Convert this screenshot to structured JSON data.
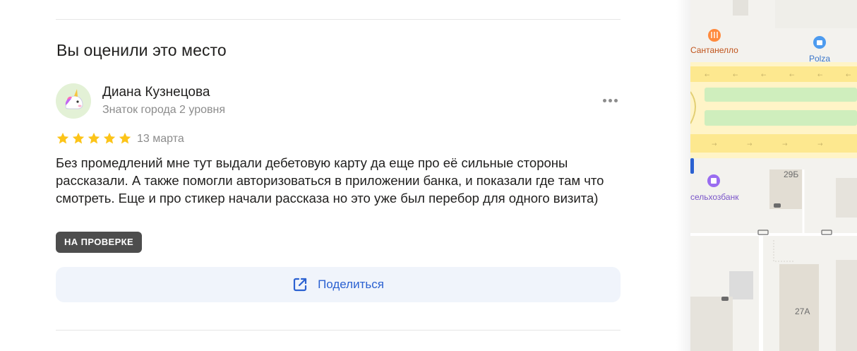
{
  "section_title": "Вы оценили это место",
  "review": {
    "author": "Диана Кузнецова",
    "author_level": "Знаток города 2 уровня",
    "rating": 5,
    "date": "13 марта",
    "text": "Без промедлений мне тут выдали дебетовую карту да еще про её сильные стороны рассказали. А также помогли авторизоваться в приложении банка, и показали где там что смотреть. Еще и про стикер начали рассказа но это уже был перебор для одного визита)",
    "status_badge": "НА ПРОВЕРКЕ",
    "avatar_icon": "unicorn-icon"
  },
  "actions": {
    "share_label": "Поделиться",
    "share_icon": "external-link-icon",
    "more_icon": "more-dots-icon"
  },
  "map": {
    "poi_restaurant": "Сантанелло",
    "poi_store": "Polza",
    "poi_bank": "сельхозбанк",
    "building_1": "29Б",
    "building_2": "27А"
  },
  "colors": {
    "star": "#fcc419",
    "link": "#2b61d1",
    "badge_bg": "#4d4d4d",
    "road": "#fde68a",
    "green": "#c8eab0"
  }
}
